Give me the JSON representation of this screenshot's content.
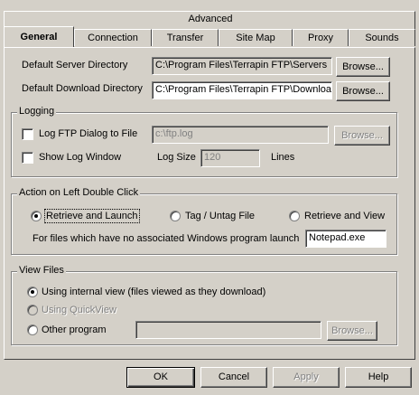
{
  "tabs_row1": [
    "Advanced"
  ],
  "tabs_row2": [
    "General",
    "Connection",
    "Transfer",
    "Site Map",
    "Proxy",
    "Sounds"
  ],
  "general": {
    "server_dir_label": "Default Server Directory",
    "server_dir_value": "C:\\Program Files\\Terrapin FTP\\Servers",
    "download_dir_label": "Default Download Directory",
    "download_dir_value": "C:\\Program Files\\Terrapin FTP\\Downloa",
    "browse_label": "Browse..."
  },
  "logging": {
    "title": "Logging",
    "log_dialog_label": "Log FTP Dialog to File",
    "log_file_value": "c:\\ftp.log",
    "show_log_label": "Show Log Window",
    "log_size_label": "Log Size",
    "log_size_value": "120",
    "lines_label": "Lines",
    "browse_label": "Browse..."
  },
  "action": {
    "title": "Action on Left Double Click",
    "opt1": "Retrieve and Launch",
    "opt2": "Tag / Untag File",
    "opt3": "Retrieve and View",
    "selected": "Retrieve and Launch",
    "no_assoc_label": "For files which have no associated Windows program launch",
    "program_value": "Notepad.exe"
  },
  "view_files": {
    "title": "View Files",
    "opt1": "Using internal view (files viewed as they download)",
    "opt2": "Using QuickView",
    "opt3": "Other program",
    "selected": "Using internal view (files viewed as they download)",
    "browse_label": "Browse..."
  },
  "buttons": {
    "ok": "OK",
    "cancel": "Cancel",
    "apply": "Apply",
    "help": "Help"
  }
}
